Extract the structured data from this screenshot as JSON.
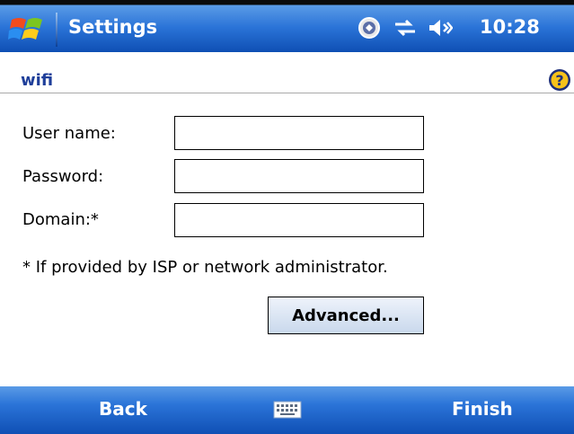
{
  "titlebar": {
    "title": "Settings",
    "clock": "10:28",
    "icons": [
      "start-flag-icon",
      "notification-icon",
      "connectivity-icon",
      "volume-icon"
    ]
  },
  "header": {
    "title": "wifi",
    "help_icon": "help-icon"
  },
  "form": {
    "username_label": "User name:",
    "username_value": "",
    "password_label": "Password:",
    "password_value": "",
    "domain_label": "Domain:*",
    "domain_value": "",
    "note": "* If provided by ISP or network administrator.",
    "advanced_label": "Advanced..."
  },
  "softkeys": {
    "left": "Back",
    "center_icon": "keyboard-icon",
    "right": "Finish"
  },
  "colors": {
    "titlebar_blue": "#2b74d8",
    "header_text": "#1f3f9a",
    "button_face": "#c9d8ec"
  }
}
